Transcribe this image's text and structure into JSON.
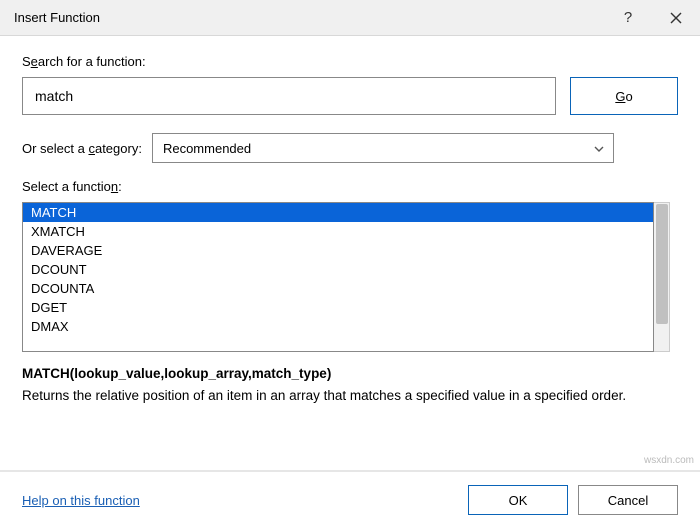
{
  "titlebar": {
    "title": "Insert Function"
  },
  "search": {
    "label_pre": "S",
    "label_u": "e",
    "label_post": "arch for a function:",
    "value": "match",
    "go_pre": "",
    "go_u": "G",
    "go_post": "o"
  },
  "category": {
    "label_pre": "Or select a ",
    "label_u": "c",
    "label_post": "ategory:",
    "selected": "Recommended"
  },
  "list": {
    "label_pre": "Select a functio",
    "label_u": "n",
    "label_post": ":",
    "items": [
      "MATCH",
      "XMATCH",
      "DAVERAGE",
      "DCOUNT",
      "DCOUNTA",
      "DGET",
      "DMAX"
    ],
    "selected_index": 0
  },
  "signature": "MATCH(lookup_value,lookup_array,match_type)",
  "description": "Returns the relative position of an item in an array that matches a specified value in a specified order.",
  "footer": {
    "help": "Help on this function",
    "ok": "OK",
    "cancel": "Cancel"
  },
  "watermark": "wsxdn.com"
}
